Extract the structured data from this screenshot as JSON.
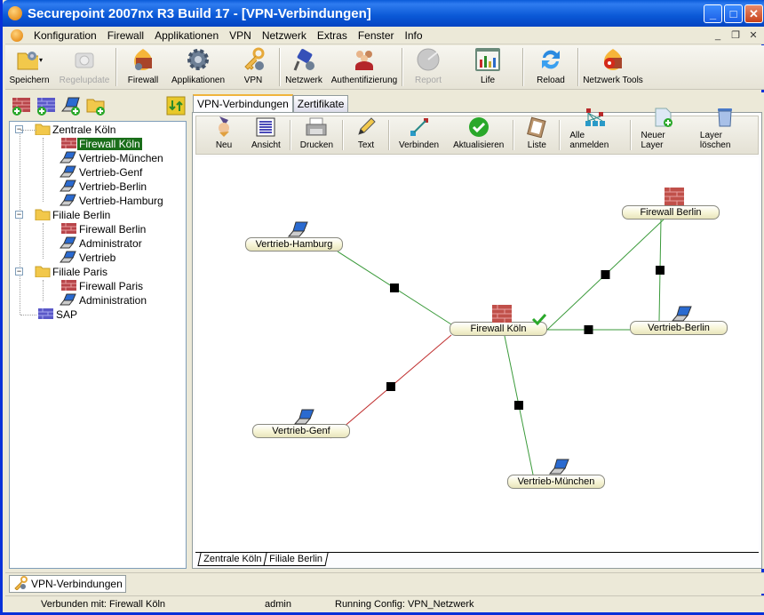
{
  "window": {
    "title": "Securepoint 2007nx R3 Build 17  - [VPN-Verbindungen]",
    "controls": {
      "minimize": "_",
      "maximize": "□",
      "close": "✕"
    },
    "mdi_controls": {
      "minimize": "_",
      "restore": "❐",
      "close": "✕"
    }
  },
  "menu": {
    "items": [
      "Konfiguration",
      "Firewall",
      "Applikationen",
      "VPN",
      "Netzwerk",
      "Extras",
      "Fenster",
      "Info"
    ]
  },
  "toolbar": {
    "buttons": [
      {
        "label": "Speichern",
        "icon": "save-folder-icon",
        "enabled": true
      },
      {
        "label": "Regelupdate",
        "icon": "rule-update-icon",
        "enabled": false
      },
      {
        "label": "Firewall",
        "icon": "firewall-icon",
        "enabled": true
      },
      {
        "label": "Applikationen",
        "icon": "gear-icon",
        "enabled": true
      },
      {
        "label": "VPN",
        "icon": "key-icon",
        "enabled": true
      },
      {
        "label": "Netzwerk",
        "icon": "network-cable-icon",
        "enabled": true
      },
      {
        "label": "Authentifizierung",
        "icon": "users-icon",
        "enabled": true
      },
      {
        "label": "Report",
        "icon": "report-icon",
        "enabled": false
      },
      {
        "label": "Life",
        "icon": "chart-icon",
        "enabled": true
      },
      {
        "label": "Reload",
        "icon": "reload-icon",
        "enabled": true
      },
      {
        "label": "Netzwerk Tools",
        "icon": "network-tools-icon",
        "enabled": true
      }
    ]
  },
  "left_tools": [
    "add-firewall-icon",
    "add-server-icon",
    "add-laptop-icon",
    "add-folder-icon",
    "sync-icon"
  ],
  "tree": {
    "groups": [
      {
        "label": "Zentrale Köln",
        "expander": "−",
        "children": [
          {
            "label": "Firewall Köln",
            "type": "firewall",
            "selected": true
          },
          {
            "label": "Vertrieb-München",
            "type": "laptop"
          },
          {
            "label": "Vertrieb-Genf",
            "type": "laptop"
          },
          {
            "label": "Vertrieb-Berlin",
            "type": "laptop"
          },
          {
            "label": "Vertrieb-Hamburg",
            "type": "laptop"
          }
        ]
      },
      {
        "label": "Filiale Berlin",
        "expander": "−",
        "children": [
          {
            "label": "Firewall Berlin",
            "type": "firewall"
          },
          {
            "label": "Administrator",
            "type": "laptop"
          },
          {
            "label": "Vertrieb",
            "type": "laptop"
          }
        ]
      },
      {
        "label": "Filiale Paris",
        "expander": "−",
        "children": [
          {
            "label": "Firewall Paris",
            "type": "firewall"
          },
          {
            "label": "Administration",
            "type": "laptop"
          }
        ]
      }
    ],
    "root_items": [
      {
        "label": "SAP",
        "type": "server"
      }
    ]
  },
  "tabs": [
    "VPN-Verbindungen",
    "Zertifikate"
  ],
  "inner_toolbar": {
    "buttons": [
      {
        "label": "Neu",
        "icon": "wizard-icon"
      },
      {
        "label": "Ansicht",
        "icon": "view-grid-icon"
      },
      {
        "label": "Drucken",
        "icon": "printer-icon"
      },
      {
        "label": "Text",
        "icon": "pencil-icon"
      },
      {
        "label": "Verbinden",
        "icon": "connect-icon"
      },
      {
        "label": "Aktualisieren",
        "icon": "check-icon"
      },
      {
        "label": "Liste",
        "icon": "clipboard-icon"
      },
      {
        "label": "Alle anmelden",
        "icon": "topology-icon"
      },
      {
        "label": "Neuer Layer",
        "icon": "new-layer-icon"
      },
      {
        "label": "Layer löschen",
        "icon": "trash-icon"
      }
    ]
  },
  "diagram": {
    "nodes": [
      {
        "id": "fw-koeln",
        "label": "Firewall Köln",
        "type": "firewall",
        "status": "connected"
      },
      {
        "id": "fw-berlin",
        "label": "Firewall Berlin",
        "type": "firewall"
      },
      {
        "id": "vt-hamburg",
        "label": "Vertrieb-Hamburg",
        "type": "laptop"
      },
      {
        "id": "vt-berlin",
        "label": "Vertrieb-Berlin",
        "type": "laptop"
      },
      {
        "id": "vt-genf",
        "label": "Vertrieb-Genf",
        "type": "laptop"
      },
      {
        "id": "vt-muenchen",
        "label": "Vertrieb-München",
        "type": "laptop"
      }
    ],
    "edges": [
      {
        "from": "fw-koeln",
        "to": "vt-hamburg",
        "color": "#3a9a3a"
      },
      {
        "from": "fw-koeln",
        "to": "fw-berlin",
        "color": "#3a9a3a"
      },
      {
        "from": "fw-koeln",
        "to": "vt-berlin",
        "color": "#3a9a3a"
      },
      {
        "from": "fw-berlin",
        "to": "vt-berlin",
        "color": "#3a9a3a"
      },
      {
        "from": "fw-koeln",
        "to": "vt-muenchen",
        "color": "#3a9a3a"
      },
      {
        "from": "fw-koeln",
        "to": "vt-genf",
        "color": "#c03030"
      }
    ]
  },
  "layer_tabs": [
    "Zentrale Köln",
    "Filiale Berlin"
  ],
  "window_tab": "VPN-Verbindungen",
  "status": {
    "connected": "Verbunden mit:  Firewall Köln",
    "user": "admin",
    "config": "Running Config: VPN_Netzwerk"
  }
}
